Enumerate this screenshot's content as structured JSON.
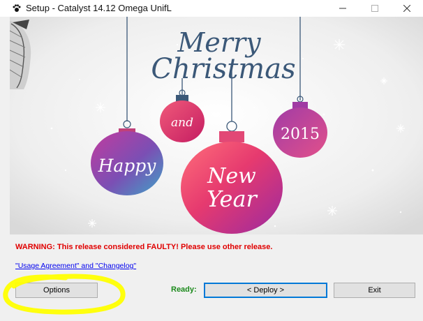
{
  "window": {
    "title": "Setup - Catalyst 14.12 Omega UnifL",
    "controls": [
      "minimize-icon",
      "maximize-icon",
      "close-icon"
    ]
  },
  "banner": {
    "line1": "Merry",
    "line2": "Christmas",
    "ornaments": {
      "and": "and",
      "year": "2015",
      "happy": "Happy",
      "new": "New",
      "year_word": "Year"
    },
    "colors": {
      "title": "#3b5878",
      "string": "#3b5878",
      "ornament_pink": "#e6406f",
      "ornament_purple": "#9b3aa8",
      "ornament_blue": "#3d8fc0"
    }
  },
  "footer": {
    "warning": "WARNING: This release considered FAULTY! Please use other release.",
    "agreement_link": "\"Usage Agreement\" and \"Changelog\"",
    "ready_label": "Ready:",
    "buttons": {
      "options": "Options",
      "deploy": "< Deploy >",
      "exit": "Exit"
    },
    "colors": {
      "warning": "#e00000",
      "link": "#0000ee",
      "ready": "#1c8a1c",
      "focus_border": "#0078d7",
      "highlight": "#ffff00"
    }
  }
}
